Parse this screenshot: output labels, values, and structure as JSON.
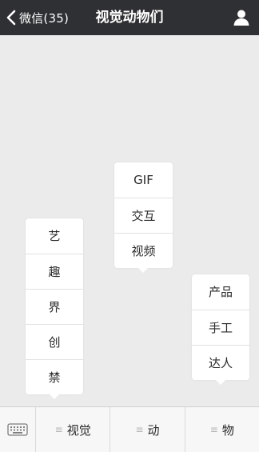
{
  "nav": {
    "back_label": "微信(35)",
    "title": "视觉动物们"
  },
  "popups": [
    {
      "items": [
        "艺",
        "趣",
        "界",
        "创",
        "禁"
      ]
    },
    {
      "items": [
        "GIF",
        "交互",
        "视频"
      ]
    },
    {
      "items": [
        "产品",
        "手工",
        "达人"
      ]
    }
  ],
  "tabbar": {
    "menu_glyph": "≡",
    "tabs": [
      {
        "label": "视觉"
      },
      {
        "label": "动"
      },
      {
        "label": "物"
      }
    ]
  }
}
